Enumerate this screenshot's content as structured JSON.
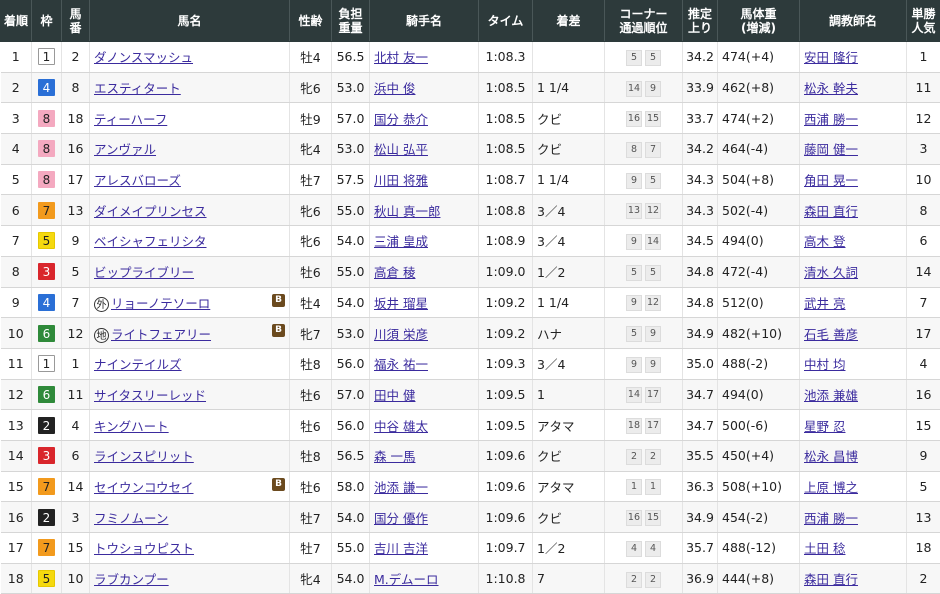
{
  "headers": {
    "rank": "着順",
    "waku": "枠",
    "umaban": [
      "馬",
      "番"
    ],
    "horse": "馬名",
    "sexage": "性齢",
    "weight": [
      "負担",
      "重量"
    ],
    "jockey": "騎手名",
    "time": "タイム",
    "margin": "着差",
    "corner": [
      "コーナー",
      "通過順位"
    ],
    "last3f": [
      "推定",
      "上り"
    ],
    "body": [
      "馬体重",
      "(増減)"
    ],
    "trainer": "調教師名",
    "pop": [
      "単勝",
      "人気"
    ]
  },
  "waku_colors": {
    "1": {
      "bg": "#ffffff",
      "fg": "#222222",
      "border": "#999999"
    },
    "2": {
      "bg": "#222222",
      "fg": "#ffffff",
      "border": "#222222"
    },
    "3": {
      "bg": "#d9262c",
      "fg": "#ffffff",
      "border": "#d9262c"
    },
    "4": {
      "bg": "#2a6fd6",
      "fg": "#ffffff",
      "border": "#2a6fd6"
    },
    "5": {
      "bg": "#f5d90f",
      "fg": "#222222",
      "border": "#e6c800"
    },
    "6": {
      "bg": "#2f8a3a",
      "fg": "#ffffff",
      "border": "#2f8a3a"
    },
    "7": {
      "bg": "#f29a1d",
      "fg": "#222222",
      "border": "#f29a1d"
    },
    "8": {
      "bg": "#f4a9c0",
      "fg": "#222222",
      "border": "#f4a9c0"
    }
  },
  "rows": [
    {
      "rank": "1",
      "waku": "1",
      "umaban": "2",
      "horse": "ダノンスマッシュ",
      "tag": "",
      "blinker": "",
      "sexage": "牡4",
      "weight": "56.5",
      "jockey": "北村 友一",
      "time": "1:08.3",
      "margin": "",
      "corner": [
        "5",
        "5"
      ],
      "last3f": "34.2",
      "body": "474",
      "diff": "(+4)",
      "trainer": "安田 隆行",
      "pop": "1"
    },
    {
      "rank": "2",
      "waku": "4",
      "umaban": "8",
      "horse": "エスティタート",
      "tag": "",
      "blinker": "",
      "sexage": "牝6",
      "weight": "53.0",
      "jockey": "浜中 俊",
      "time": "1:08.5",
      "margin": "1 1/4",
      "corner": [
        "14",
        "9"
      ],
      "last3f": "33.9",
      "body": "462",
      "diff": "(+8)",
      "trainer": "松永 幹夫",
      "pop": "11"
    },
    {
      "rank": "3",
      "waku": "8",
      "umaban": "18",
      "horse": "ティーハーフ",
      "tag": "",
      "blinker": "",
      "sexage": "牡9",
      "weight": "57.0",
      "jockey": "国分 恭介",
      "time": "1:08.5",
      "margin": "クビ",
      "corner": [
        "16",
        "15"
      ],
      "last3f": "33.7",
      "body": "474",
      "diff": "(+2)",
      "trainer": "西浦 勝一",
      "pop": "12"
    },
    {
      "rank": "4",
      "waku": "8",
      "umaban": "16",
      "horse": "アンヴァル",
      "tag": "",
      "blinker": "",
      "sexage": "牝4",
      "weight": "53.0",
      "jockey": "松山 弘平",
      "time": "1:08.5",
      "margin": "クビ",
      "corner": [
        "8",
        "7"
      ],
      "last3f": "34.2",
      "body": "464",
      "diff": "(-4)",
      "trainer": "藤岡 健一",
      "pop": "3"
    },
    {
      "rank": "5",
      "waku": "8",
      "umaban": "17",
      "horse": "アレスバローズ",
      "tag": "",
      "blinker": "",
      "sexage": "牡7",
      "weight": "57.5",
      "jockey": "川田 将雅",
      "time": "1:08.7",
      "margin": "1 1/4",
      "corner": [
        "9",
        "5"
      ],
      "last3f": "34.3",
      "body": "504",
      "diff": "(+8)",
      "trainer": "角田 晃一",
      "pop": "10"
    },
    {
      "rank": "6",
      "waku": "7",
      "umaban": "13",
      "horse": "ダイメイプリンセス",
      "tag": "",
      "blinker": "",
      "sexage": "牝6",
      "weight": "55.0",
      "jockey": "秋山 真一郎",
      "time": "1:08.8",
      "margin": "3／4",
      "corner": [
        "13",
        "12"
      ],
      "last3f": "34.3",
      "body": "502",
      "diff": "(-4)",
      "trainer": "森田 直行",
      "pop": "8"
    },
    {
      "rank": "7",
      "waku": "5",
      "umaban": "9",
      "horse": "ベイシャフェリシタ",
      "tag": "",
      "blinker": "",
      "sexage": "牝6",
      "weight": "54.0",
      "jockey": "三浦 皇成",
      "time": "1:08.9",
      "margin": "3／4",
      "corner": [
        "9",
        "14"
      ],
      "last3f": "34.5",
      "body": "494",
      "diff": "(0)",
      "trainer": "高木 登",
      "pop": "6"
    },
    {
      "rank": "8",
      "waku": "3",
      "umaban": "5",
      "horse": "ビップライブリー",
      "tag": "",
      "blinker": "",
      "sexage": "牡6",
      "weight": "55.0",
      "jockey": "高倉 稜",
      "time": "1:09.0",
      "margin": "1／2",
      "corner": [
        "5",
        "5"
      ],
      "last3f": "34.8",
      "body": "472",
      "diff": "(-4)",
      "trainer": "清水 久詞",
      "pop": "14"
    },
    {
      "rank": "9",
      "waku": "4",
      "umaban": "7",
      "horse": "リョーノテソーロ",
      "tag": "外",
      "blinker": "B",
      "sexage": "牡4",
      "weight": "54.0",
      "jockey": "坂井 瑠星",
      "time": "1:09.2",
      "margin": "1 1/4",
      "corner": [
        "9",
        "12"
      ],
      "last3f": "34.8",
      "body": "512",
      "diff": "(0)",
      "trainer": "武井 亮",
      "pop": "7"
    },
    {
      "rank": "10",
      "waku": "6",
      "umaban": "12",
      "horse": "ライトフェアリー",
      "tag": "地",
      "blinker": "B",
      "sexage": "牝7",
      "weight": "53.0",
      "jockey": "川須 栄彦",
      "time": "1:09.2",
      "margin": "ハナ",
      "corner": [
        "5",
        "9"
      ],
      "last3f": "34.9",
      "body": "482",
      "diff": "(+10)",
      "trainer": "石毛 善彦",
      "pop": "17"
    },
    {
      "rank": "11",
      "waku": "1",
      "umaban": "1",
      "horse": "ナインテイルズ",
      "tag": "",
      "blinker": "",
      "sexage": "牡8",
      "weight": "56.0",
      "jockey": "福永 祐一",
      "time": "1:09.3",
      "margin": "3／4",
      "corner": [
        "9",
        "9"
      ],
      "last3f": "35.0",
      "body": "488",
      "diff": "(-2)",
      "trainer": "中村 均",
      "pop": "4"
    },
    {
      "rank": "12",
      "waku": "6",
      "umaban": "11",
      "horse": "サイタスリーレッド",
      "tag": "",
      "blinker": "",
      "sexage": "牡6",
      "weight": "57.0",
      "jockey": "田中 健",
      "time": "1:09.5",
      "margin": "1",
      "corner": [
        "14",
        "17"
      ],
      "last3f": "34.7",
      "body": "494",
      "diff": "(0)",
      "trainer": "池添 兼雄",
      "pop": "16"
    },
    {
      "rank": "13",
      "waku": "2",
      "umaban": "4",
      "horse": "キングハート",
      "tag": "",
      "blinker": "",
      "sexage": "牡6",
      "weight": "56.0",
      "jockey": "中谷 雄太",
      "time": "1:09.5",
      "margin": "アタマ",
      "corner": [
        "18",
        "17"
      ],
      "last3f": "34.7",
      "body": "500",
      "diff": "(-6)",
      "trainer": "星野 忍",
      "pop": "15"
    },
    {
      "rank": "14",
      "waku": "3",
      "umaban": "6",
      "horse": "ラインスピリット",
      "tag": "",
      "blinker": "",
      "sexage": "牡8",
      "weight": "56.5",
      "jockey": "森 一馬",
      "time": "1:09.6",
      "margin": "クビ",
      "corner": [
        "2",
        "2"
      ],
      "last3f": "35.5",
      "body": "450",
      "diff": "(+4)",
      "trainer": "松永 昌博",
      "pop": "9"
    },
    {
      "rank": "15",
      "waku": "7",
      "umaban": "14",
      "horse": "セイウンコウセイ",
      "tag": "",
      "blinker": "B",
      "sexage": "牡6",
      "weight": "58.0",
      "jockey": "池添 謙一",
      "time": "1:09.6",
      "margin": "アタマ",
      "corner": [
        "1",
        "1"
      ],
      "last3f": "36.3",
      "body": "508",
      "diff": "(+10)",
      "trainer": "上原 博之",
      "pop": "5"
    },
    {
      "rank": "16",
      "waku": "2",
      "umaban": "3",
      "horse": "フミノムーン",
      "tag": "",
      "blinker": "",
      "sexage": "牡7",
      "weight": "54.0",
      "jockey": "国分 優作",
      "time": "1:09.6",
      "margin": "クビ",
      "corner": [
        "16",
        "15"
      ],
      "last3f": "34.9",
      "body": "454",
      "diff": "(-2)",
      "trainer": "西浦 勝一",
      "pop": "13"
    },
    {
      "rank": "17",
      "waku": "7",
      "umaban": "15",
      "horse": "トウショウピスト",
      "tag": "",
      "blinker": "",
      "sexage": "牡7",
      "weight": "55.0",
      "jockey": "吉川 吉洋",
      "time": "1:09.7",
      "margin": "1／2",
      "corner": [
        "4",
        "4"
      ],
      "last3f": "35.7",
      "body": "488",
      "diff": "(-12)",
      "trainer": "土田 稔",
      "pop": "18"
    },
    {
      "rank": "18",
      "waku": "5",
      "umaban": "10",
      "horse": "ラブカンプー",
      "tag": "",
      "blinker": "",
      "sexage": "牝4",
      "weight": "54.0",
      "jockey": "M.デムーロ",
      "time": "1:10.8",
      "margin": "7",
      "corner": [
        "2",
        "2"
      ],
      "last3f": "36.9",
      "body": "444",
      "diff": "(+8)",
      "trainer": "森田 直行",
      "pop": "2"
    }
  ]
}
